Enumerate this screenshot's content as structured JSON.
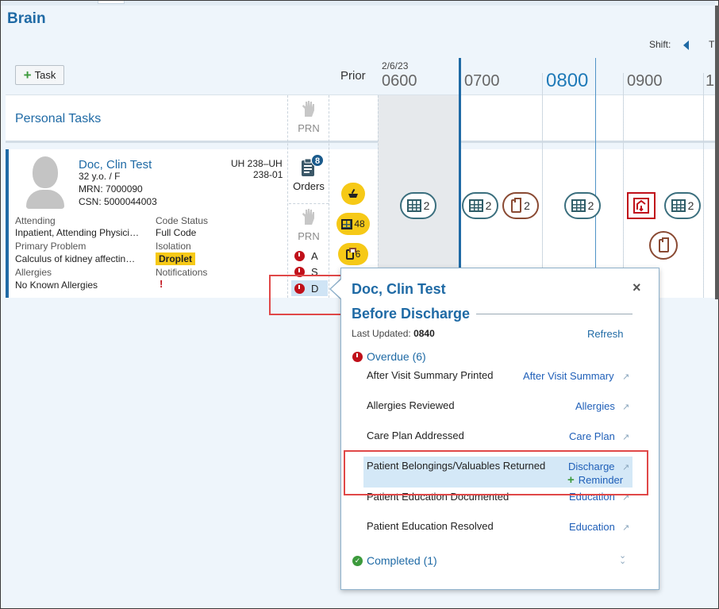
{
  "app": {
    "title": "Brain"
  },
  "shift": {
    "label": "Shift:",
    "next_label": "T"
  },
  "toolbar": {
    "task_button": "Task"
  },
  "timeline": {
    "prior_label": "Prior",
    "date": "2/6/23",
    "hours": [
      "0600",
      "0700",
      "0800",
      "0900",
      "1"
    ],
    "current_hour": "0800"
  },
  "personal": {
    "label": "Personal Tasks",
    "prn": "PRN"
  },
  "patient": {
    "name": "Doc, Clin Test",
    "age_sex": "32 y.o. / F",
    "mrn_label": "MRN:",
    "mrn": "7000090",
    "csn_label": "CSN:",
    "csn": "5000044003",
    "room_line1": "UH 238–UH",
    "room_line2": "238-01",
    "attending_label": "Attending",
    "attending": "Inpatient, Attending Physici…",
    "code_status_label": "Code Status",
    "code_status": "Full Code",
    "primary_problem_label": "Primary Problem",
    "primary_problem": "Calculus of kidney affectin…",
    "isolation_label": "Isolation",
    "isolation": "Droplet",
    "allergies_label": "Allergies",
    "allergies": "No Known Allergies",
    "notifications_label": "Notifications",
    "notifications_mark": "!"
  },
  "columns": {
    "orders_label": "Orders",
    "orders_count": "8",
    "prn_label": "PRN",
    "asd": [
      "A",
      "S",
      "D"
    ]
  },
  "prior_icons": {
    "flask_count": "48",
    "clip_count": "6"
  },
  "task_icons": [
    {
      "kind": "grid",
      "count": "2"
    },
    {
      "kind": "grid",
      "count": "2"
    },
    {
      "kind": "clipboard",
      "count": "2"
    },
    {
      "kind": "grid",
      "count": "2"
    },
    {
      "kind": "grid",
      "count": "2"
    }
  ],
  "popup": {
    "title": "Doc, Clin Test",
    "subtitle": "Before Discharge",
    "close": "×",
    "last_updated_label": "Last Updated:",
    "last_updated": "0840",
    "refresh": "Refresh",
    "overdue_label": "Overdue (6)",
    "items": [
      {
        "label": "After Visit Summary Printed",
        "link": "After Visit Summary"
      },
      {
        "label": "Allergies Reviewed",
        "link": "Allergies"
      },
      {
        "label": "Care Plan Addressed",
        "link": "Care Plan"
      },
      {
        "label": "Patient Belongings/Valuables Returned",
        "link": "Discharge"
      },
      {
        "label": "Patient Education Documented",
        "link": "Education"
      },
      {
        "label": "Patient Education Resolved",
        "link": "Education"
      }
    ],
    "reminder": "Reminder",
    "completed_label": "Completed (1)"
  },
  "colors": {
    "accent": "#1f6aa5",
    "isolation": "#f6c917",
    "alert": "#c0101a",
    "highlight": "#e04848"
  }
}
